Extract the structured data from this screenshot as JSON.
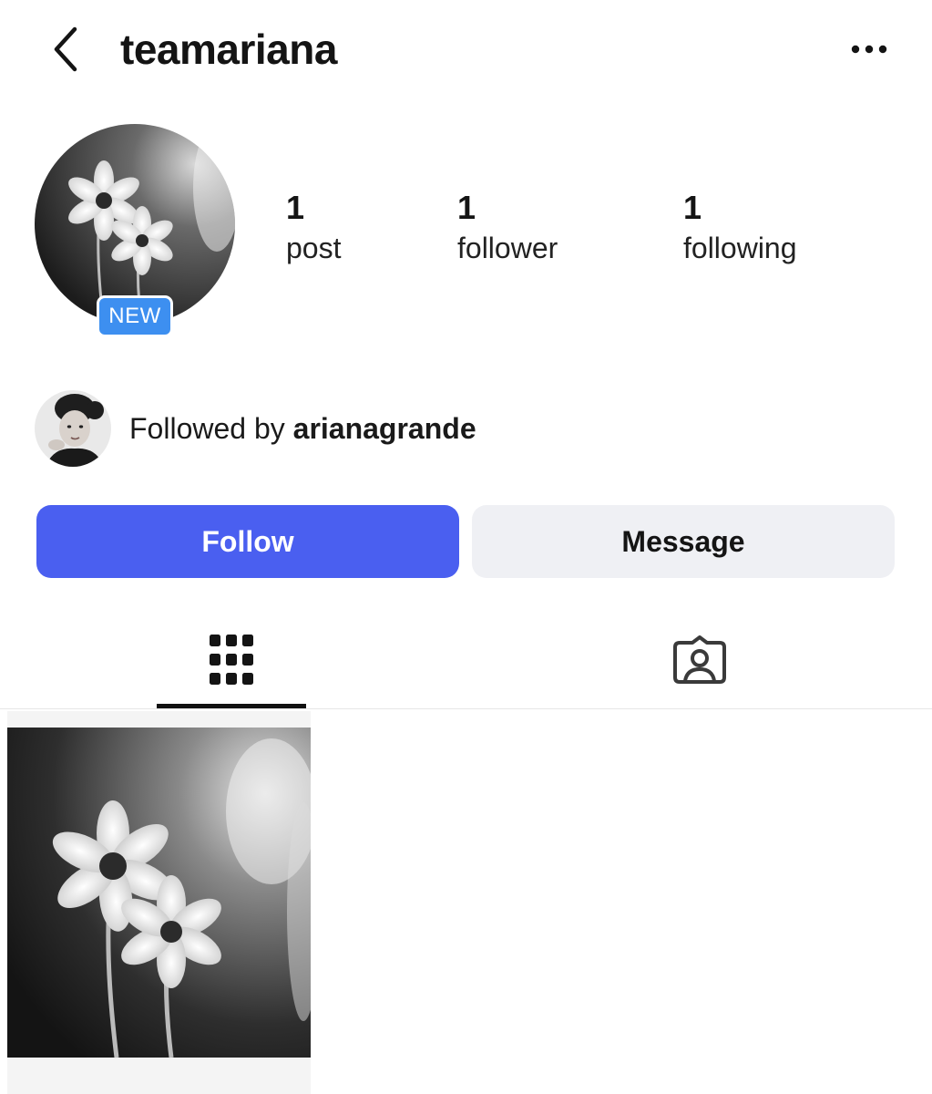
{
  "header": {
    "username": "teamariana"
  },
  "profile": {
    "badge": "NEW",
    "stats": [
      {
        "count": "1",
        "label": "post"
      },
      {
        "count": "1",
        "label": "follower"
      },
      {
        "count": "1",
        "label": "following"
      }
    ],
    "followed_by_prefix": "Followed by ",
    "followed_by_user": "arianagrande"
  },
  "actions": {
    "follow_label": "Follow",
    "message_label": "Message"
  },
  "tabs": {
    "icons": [
      "grid-icon",
      "tagged-icon"
    ],
    "active": "grid-icon"
  },
  "colors": {
    "follow_button": "#4a5ff0",
    "message_button": "#eff0f4",
    "badge": "#3d8ff0"
  }
}
